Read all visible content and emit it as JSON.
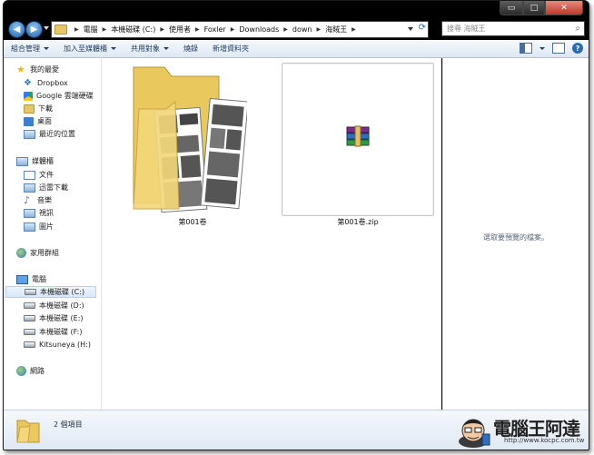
{
  "window": {
    "controls": {
      "min": "▭",
      "max": "□",
      "close": "✕"
    }
  },
  "address": {
    "crumbs": [
      "電腦",
      "本機磁碟 (C:)",
      "使用者",
      "Foxler",
      "Downloads",
      "down",
      "海賊王"
    ],
    "search_placeholder": "搜尋 海賊王"
  },
  "commands": {
    "organize": "組合管理",
    "include": "加入至媒體櫃",
    "share": "共用對象",
    "burn": "燒錄",
    "new_folder": "新增資料夾"
  },
  "nav": {
    "favorites": "我的最愛",
    "dropbox": "Dropbox",
    "gdrive": "Google 雲端硬碟",
    "downloads": "下載",
    "desktop": "桌面",
    "recent": "最近的位置",
    "libraries": "媒體櫃",
    "docs": "文件",
    "thunder": "迅雷下載",
    "music": "音樂",
    "videos": "視訊",
    "pictures": "圖片",
    "homegroup": "家用群組",
    "computer": "電腦",
    "drive_c": "本機磁碟 (C:)",
    "drive_d": "本機磁碟 (D:)",
    "drive_e": "本機磁碟 (E:)",
    "drive_f": "本機磁碟 (F:)",
    "drive_h": "Kitsuneya (H:)",
    "network": "網路"
  },
  "files": [
    {
      "name": "第001卷",
      "type": "folder"
    },
    {
      "name": "第001卷.zip",
      "type": "zip"
    }
  ],
  "preview_text": "選取要預覽的檔案。",
  "status": {
    "count": "2 個項目"
  },
  "watermark": {
    "logo": "電腦王阿達",
    "url": "http://www.kocpc.com.tw"
  }
}
